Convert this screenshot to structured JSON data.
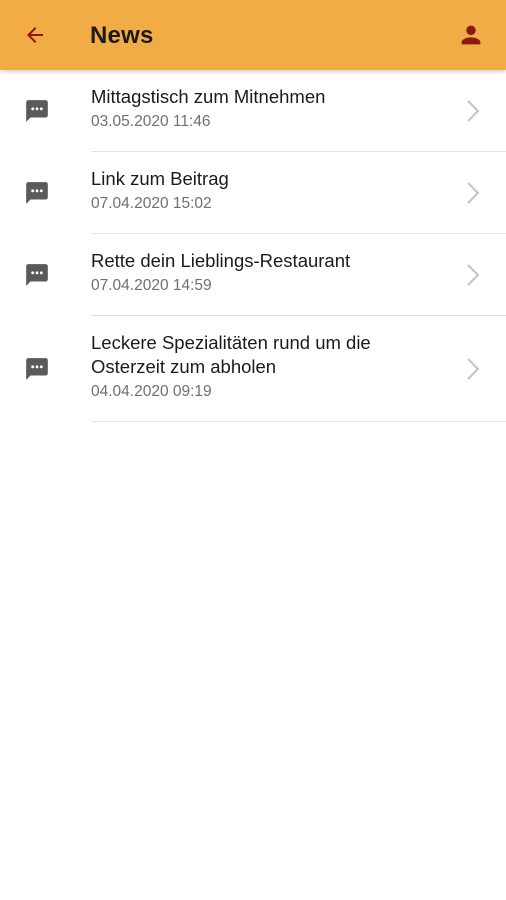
{
  "app_bar": {
    "title": "News",
    "background": "#f2ac45",
    "icon_color": "#8b1a14",
    "back_icon": "arrow-left-icon",
    "profile_icon": "person-icon"
  },
  "news": [
    {
      "title": "Mittagstisch zum Mitnehmen",
      "date": "03.05.2020 11:46"
    },
    {
      "title": "Link zum Beitrag",
      "date": "07.04.2020 15:02"
    },
    {
      "title": "Rette dein Lieblings-Restaurant",
      "date": "07.04.2020 14:59"
    },
    {
      "title": "Leckere Spezialitäten rund um die Osterzeit zum abholen",
      "date": "04.04.2020 09:19"
    }
  ],
  "item_icon": "chat-bubble-icon",
  "item_icon_color": "#5a5a5a",
  "chevron_color": "#c4c4c4"
}
